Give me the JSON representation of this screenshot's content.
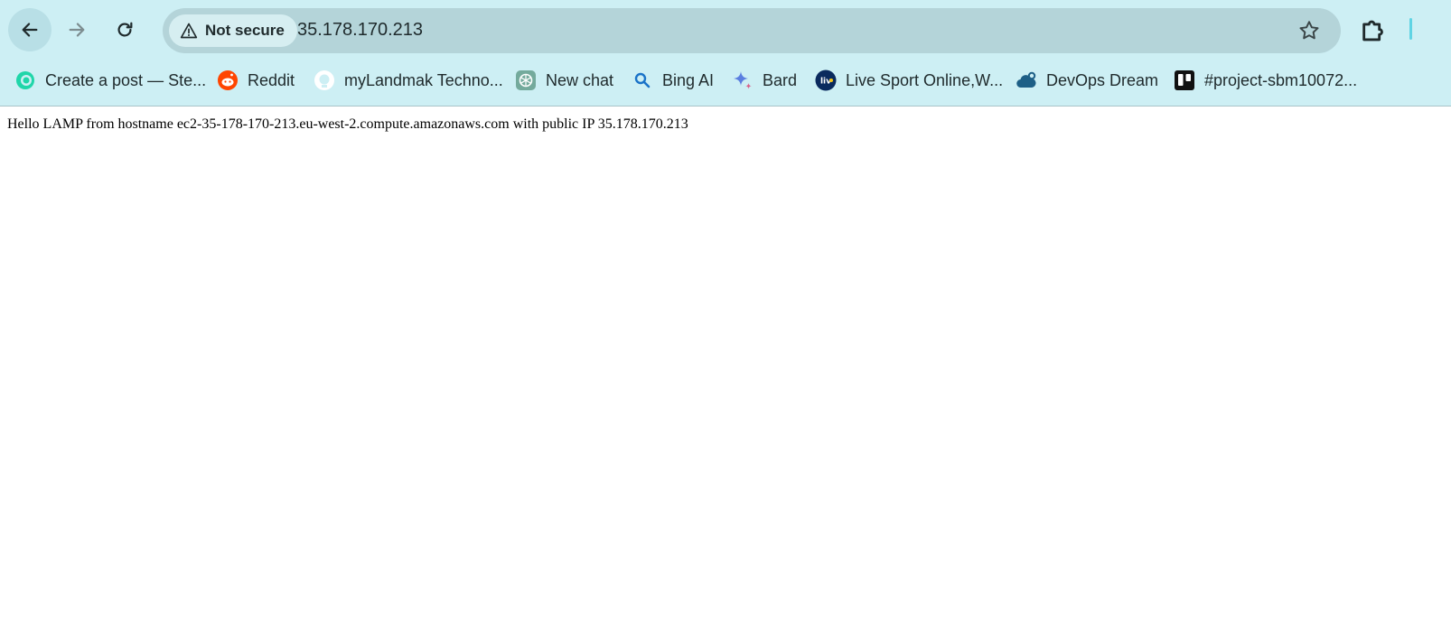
{
  "browser": {
    "security_label": "Not secure",
    "url": "35.178.170.213",
    "colors": {
      "frame": "#cdeff4",
      "omnibox": "#b4d4d9",
      "chip": "#d6eef1"
    }
  },
  "bookmarks": [
    {
      "label": "Create a post — Ste...",
      "icon": "steemit-icon"
    },
    {
      "label": "Reddit",
      "icon": "reddit-icon"
    },
    {
      "label": "myLandmak Techno...",
      "icon": "github-icon"
    },
    {
      "label": "New chat",
      "icon": "openai-icon"
    },
    {
      "label": "Bing AI",
      "icon": "search-icon"
    },
    {
      "label": "Bard",
      "icon": "sparkle-icon"
    },
    {
      "label": "Live Sport Online,W...",
      "icon": "live-icon"
    },
    {
      "label": "DevOps Dream",
      "icon": "cloud-gear-icon"
    },
    {
      "label": "#project-sbm10072...",
      "icon": "trello-icon"
    }
  ],
  "page": {
    "message": "Hello LAMP from hostname ec2-35-178-170-213.eu-west-2.compute.amazonaws.com with public IP 35.178.170.213"
  }
}
